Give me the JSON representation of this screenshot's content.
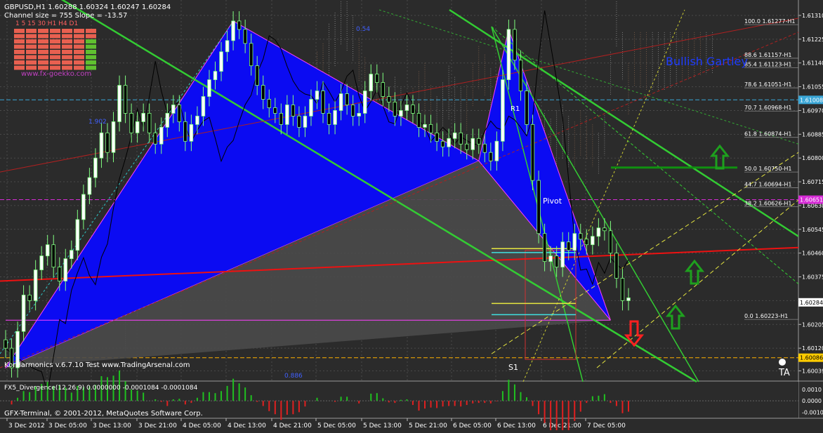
{
  "header": {
    "symbol_line": "GBPUSD,H1  1.60288 1.60324 1.60247 1.60284",
    "channel_line": "Channel size = 755 Slope = -13.57",
    "timeframes": "1  5  15  30  H1  H4  D1",
    "site": "www.fx-goekko.com"
  },
  "chart_text": {
    "pattern_title": "Bullish Gartley",
    "pivot": "Pivot",
    "s1": "S1",
    "r1": "R1",
    "indicator_footer": "KorHarmonics v.6.7.10 Test  www.TradingArsenal.com",
    "copyright": "GFX-Terminal, © 2001-2012, MetaQuotes Software Corp.",
    "level_a": "1.902",
    "level_b": "0.54",
    "level_c": "0.886",
    "oscillator_label": "FX5_Divergence(12,26,9) 0.0000000 -0.0001084 -0.0001084"
  },
  "chart_data": {
    "type": "candlestick",
    "symbol": "GBPUSD",
    "timeframe": "H1",
    "ohlc_current": {
      "open": 1.60288,
      "high": 1.60324,
      "low": 1.60247,
      "close": 1.60284
    },
    "y_axis_ticks": [
      1.6131,
      1.61225,
      1.6114,
      1.61055,
      1.6097,
      1.60885,
      1.608,
      1.60715,
      1.6063,
      1.60545,
      1.6046,
      1.60375,
      1.6029,
      1.60205,
      1.6012,
      1.60039
    ],
    "ylim": [
      1.60025,
      1.6133
    ],
    "x_axis_labels": [
      "3 Dec 2012",
      "3 Dec 05:00",
      "3 Dec 13:00",
      "3 Dec 21:00",
      "4 Dec 05:00",
      "4 Dec 13:00",
      "4 Dec 21:00",
      "5 Dec 05:00",
      "5 Dec 13:00",
      "5 Dec 21:00",
      "6 Dec 05:00",
      "6 Dec 13:00",
      "6 Dec 21:00",
      "7 Dec 05:00"
    ],
    "price_markers": [
      {
        "label": "1.61008",
        "price": 1.61008,
        "color": "#3aa6d6"
      },
      {
        "label": "1.60651",
        "price": 1.60651,
        "color": "#d62bd6"
      },
      {
        "label": "1.60284",
        "price": 1.60284,
        "color": "#ffffff"
      },
      {
        "label": "1.60086",
        "price": 1.60086,
        "color": "#ffcc00"
      }
    ],
    "fib_levels": [
      {
        "label": "100.0  1.61277-H1",
        "price": 1.61277
      },
      {
        "label": "88.6  1.61157-H1",
        "price": 1.61157
      },
      {
        "label": "85.4  1.61123-H1",
        "price": 1.61123
      },
      {
        "label": "78.6  1.61051-H1",
        "price": 1.61051
      },
      {
        "label": "70.7  1.60968-H1",
        "price": 1.60968
      },
      {
        "label": "61.8  1.60874-H1",
        "price": 1.60874
      },
      {
        "label": "50.0  1.60750-H1",
        "price": 1.6075
      },
      {
        "label": "44.7  1.60694-H1",
        "price": 1.60694
      },
      {
        "label": "38.2  1.60626-H1",
        "price": 1.60626
      },
      {
        "label": "0.0  1.60223-H1",
        "price": 1.60223
      }
    ],
    "oscillator_ticks": [
      0.001,
      0.0,
      -0.001
    ],
    "oscillator_ylim": [
      -0.0014,
      0.0013
    ],
    "closes": [
      1.6012,
      1.6005,
      1.6018,
      1.6031,
      1.6029,
      1.604,
      1.6045,
      1.6049,
      1.6041,
      1.6036,
      1.6044,
      1.6047,
      1.6058,
      1.6067,
      1.6073,
      1.608,
      1.6089,
      1.6082,
      1.6093,
      1.6106,
      1.6096,
      1.6089,
      1.6093,
      1.6096,
      1.6089,
      1.6085,
      1.6091,
      1.6096,
      1.6099,
      1.6093,
      1.6086,
      1.6092,
      1.6095,
      1.6102,
      1.6108,
      1.6111,
      1.6118,
      1.6122,
      1.6129,
      1.6126,
      1.6121,
      1.6113,
      1.6106,
      1.6101,
      1.6098,
      1.6096,
      1.6092,
      1.6099,
      1.6095,
      1.6091,
      1.6095,
      1.6101,
      1.6104,
      1.6096,
      1.6092,
      1.6097,
      1.6103,
      1.6099,
      1.6095,
      1.6096,
      1.6104,
      1.611,
      1.6107,
      1.6102,
      1.61,
      1.6095,
      1.6097,
      1.6099,
      1.6096,
      1.6091,
      1.6092,
      1.6089,
      1.6086,
      1.6084,
      1.6087,
      1.6089,
      1.6085,
      1.6083,
      1.6087,
      1.6085,
      1.6082,
      1.6079,
      1.6086,
      1.6108,
      1.6126,
      1.6115,
      1.6104,
      1.6092,
      1.6072,
      1.6053,
      1.6043,
      1.6045,
      1.6041,
      1.605,
      1.6047,
      1.6053,
      1.6051,
      1.6049,
      1.6052,
      1.6055,
      1.6054,
      1.6046,
      1.6037,
      1.6029,
      1.603
    ]
  }
}
